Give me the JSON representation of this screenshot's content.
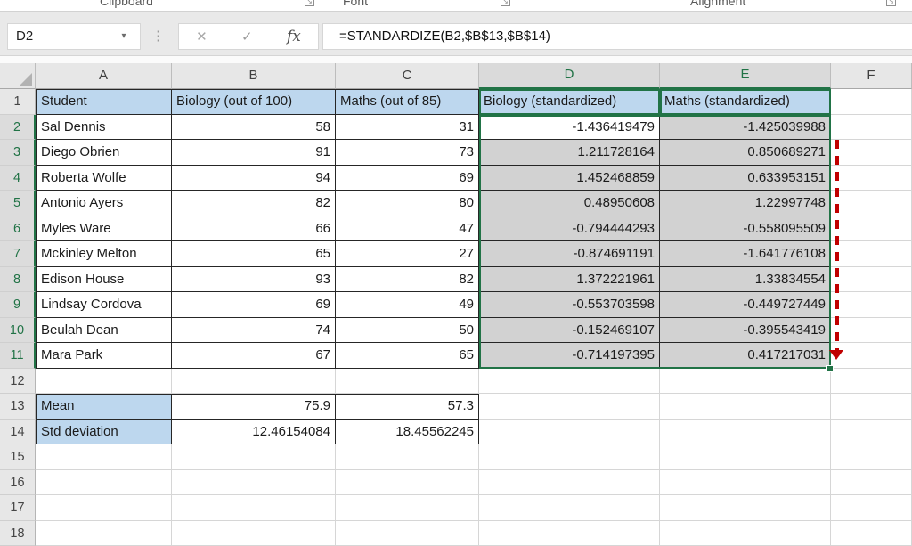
{
  "ribbon": {
    "groups": [
      {
        "label": "Clipboard"
      },
      {
        "label": "Font"
      },
      {
        "label": "Alignment"
      }
    ]
  },
  "formula_bar": {
    "name_box": "D2",
    "dropdown_glyph": "▾",
    "dots_glyph": "⋮",
    "cancel_glyph": "✕",
    "enter_glyph": "✓",
    "fx_label": "fx",
    "formula": "=STANDARDIZE(B2,$B$13,$B$14)"
  },
  "sheet": {
    "columns": [
      "A",
      "B",
      "C",
      "D",
      "E",
      "F"
    ],
    "selected_columns": [
      "D",
      "E"
    ],
    "selected_rows": [
      2,
      3,
      4,
      5,
      6,
      7,
      8,
      9,
      10,
      11
    ],
    "active_cell": "D2",
    "rows": [
      {
        "n": "1",
        "A": "Student",
        "B": "Biology (out of 100)",
        "C": "Maths (out of 85)",
        "D": "Biology (standardized)",
        "E": "Maths (standardized)"
      },
      {
        "n": "2",
        "A": "Sal Dennis",
        "B": "58",
        "C": "31",
        "D": "-1.436419479",
        "E": "-1.425039988"
      },
      {
        "n": "3",
        "A": "Diego Obrien",
        "B": "91",
        "C": "73",
        "D": "1.211728164",
        "E": "0.850689271"
      },
      {
        "n": "4",
        "A": "Roberta Wolfe",
        "B": "94",
        "C": "69",
        "D": "1.452468859",
        "E": "0.633953151"
      },
      {
        "n": "5",
        "A": "Antonio Ayers",
        "B": "82",
        "C": "80",
        "D": "0.48950608",
        "E": "1.22997748"
      },
      {
        "n": "6",
        "A": "Myles Ware",
        "B": "66",
        "C": "47",
        "D": "-0.794444293",
        "E": "-0.558095509"
      },
      {
        "n": "7",
        "A": "Mckinley Melton",
        "B": "65",
        "C": "27",
        "D": "-0.874691191",
        "E": "-1.641776108"
      },
      {
        "n": "8",
        "A": "Edison House",
        "B": "93",
        "C": "82",
        "D": "1.372221961",
        "E": "1.33834554"
      },
      {
        "n": "9",
        "A": "Lindsay Cordova",
        "B": "69",
        "C": "49",
        "D": "-0.553703598",
        "E": "-0.449727449"
      },
      {
        "n": "10",
        "A": "Beulah Dean",
        "B": "74",
        "C": "50",
        "D": "-0.152469107",
        "E": "-0.395543419"
      },
      {
        "n": "11",
        "A": "Mara Park",
        "B": "67",
        "C": "65",
        "D": "-0.714197395",
        "E": "0.417217031"
      },
      {
        "n": "12"
      },
      {
        "n": "13",
        "A": "Mean",
        "B": "75.9",
        "C": "57.3"
      },
      {
        "n": "14",
        "A": "Std deviation",
        "B": "12.46154084",
        "C": "18.45562245"
      },
      {
        "n": "15"
      },
      {
        "n": "16"
      },
      {
        "n": "17"
      },
      {
        "n": "18"
      }
    ]
  },
  "colors": {
    "selection_green": "#217346",
    "annotation_red": "#C00000",
    "header_blue": "#BDD7EE",
    "selected_cell_gray": "#D2D2D2"
  }
}
